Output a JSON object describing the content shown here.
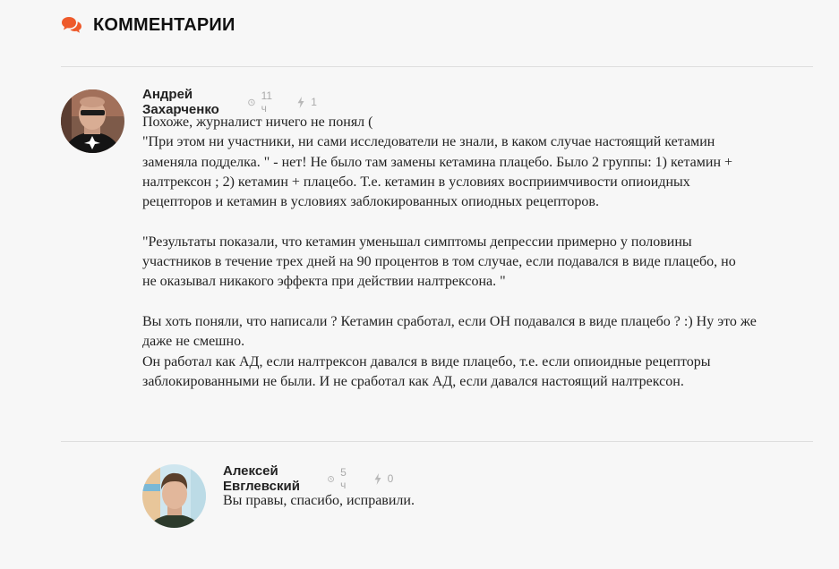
{
  "section": {
    "title": "КОММЕНТАРИИ",
    "icon": "comments-icon",
    "accent_color": "#ee5a2b"
  },
  "comments": [
    {
      "author": "Андрей Захарченко",
      "time": "11 ч",
      "rating": "1",
      "lines": [
        "Похоже, журналист ничего не понял (",
        "\"При этом ни участники, ни сами исследователи не знали, в каком случае настоящий кетамин",
        "заменяла подделка. \" - нет! Не было там замены кетамина плацебо. Было 2 группы: 1) кетамин +",
        "налтрексон ; 2) кетамин + плацебо. Т.е. кетамин в условиях восприимчивости опиоидных",
        "рецепторов и кетамин в условиях заблокированных опиодных рецепторов.",
        "",
        "\"Результаты показали, что кетамин уменьшал симптомы депрессии примерно у половины",
        "участников в течение трех дней на 90 процентов в том случае, если подавался в виде плацебо, но",
        "не оказывал никакого эффекта при действии налтрексона. \"",
        "",
        "Вы хоть поняли, что написали ? Кетамин сработал, если ОН подавался в виде плацебо ? :) Ну это же",
        "даже не смешно.",
        "Он работал как АД, если налтрексон давался в виде плацебо, т.е. если опиоидные рецепторы",
        "заблокированными не были. И не сработал как АД, если давался настоящий налтрексон."
      ]
    },
    {
      "author": "Алексей Евглевский",
      "time": "5 ч",
      "rating": "0",
      "lines": [
        "Вы правы, спасибо, исправили."
      ]
    }
  ]
}
